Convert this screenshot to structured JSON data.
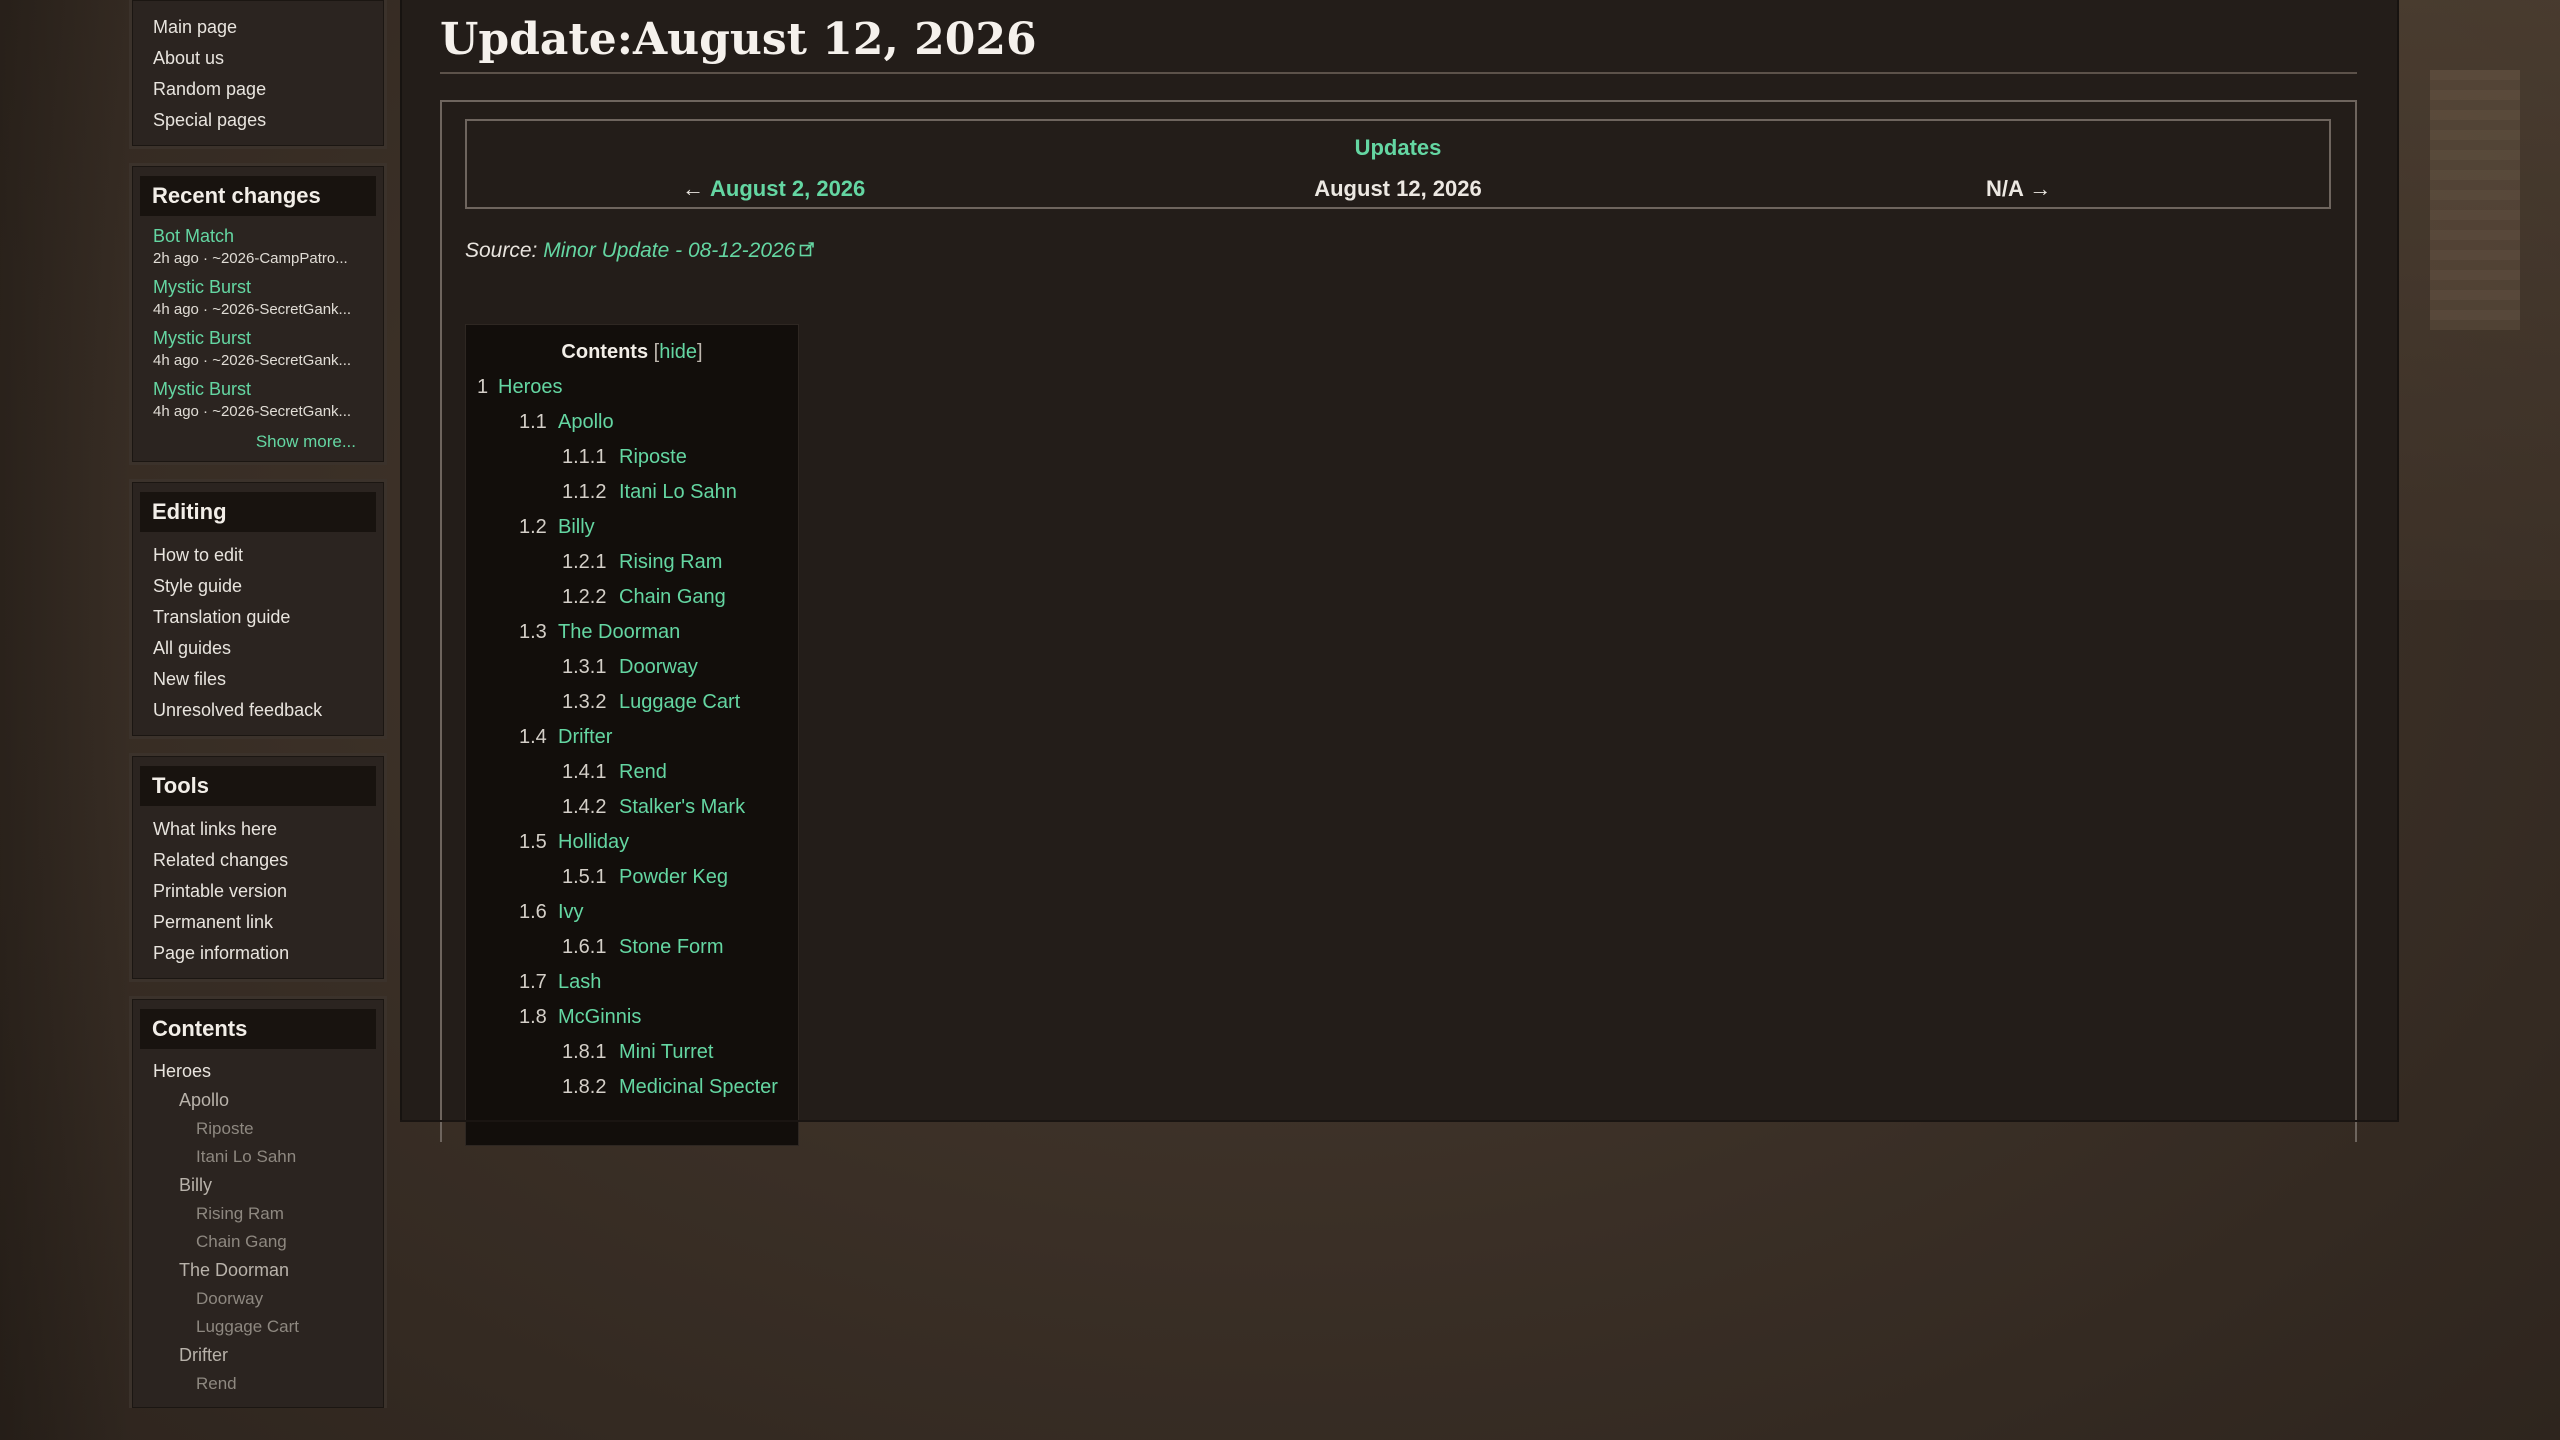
{
  "page": {
    "title": "Update:August 12, 2026"
  },
  "sidebar": {
    "navigation": [
      "Main page",
      "About us",
      "Random page",
      "Special pages"
    ],
    "recent_changes": {
      "heading": "Recent changes",
      "items": [
        {
          "title": "Bot Match",
          "meta": "2h ago · ~2026-CampPatro..."
        },
        {
          "title": "Mystic Burst",
          "meta": "4h ago · ~2026-SecretGank..."
        },
        {
          "title": "Mystic Burst",
          "meta": "4h ago · ~2026-SecretGank..."
        },
        {
          "title": "Mystic Burst",
          "meta": "4h ago · ~2026-SecretGank..."
        }
      ],
      "show_more": "Show more..."
    },
    "editing": {
      "heading": "Editing",
      "items": [
        "How to edit",
        "Style guide",
        "Translation guide",
        "All guides",
        "New files",
        "Unresolved feedback"
      ]
    },
    "tools": {
      "heading": "Tools",
      "items": [
        "What links here",
        "Related changes",
        "Printable version",
        "Permanent link",
        "Page information"
      ]
    },
    "contents": {
      "heading": "Contents",
      "items": [
        {
          "level": 1,
          "label": "Heroes"
        },
        {
          "level": 2,
          "label": "Apollo"
        },
        {
          "level": 3,
          "label": "Riposte"
        },
        {
          "level": 3,
          "label": "Itani Lo Sahn"
        },
        {
          "level": 2,
          "label": "Billy"
        },
        {
          "level": 3,
          "label": "Rising Ram"
        },
        {
          "level": 3,
          "label": "Chain Gang"
        },
        {
          "level": 2,
          "label": "The Doorman"
        },
        {
          "level": 3,
          "label": "Doorway"
        },
        {
          "level": 3,
          "label": "Luggage Cart"
        },
        {
          "level": 2,
          "label": "Drifter"
        },
        {
          "level": 3,
          "label": "Rend"
        }
      ]
    }
  },
  "updates_nav": {
    "title": "Updates",
    "prev_label": "August 2, 2026",
    "prev_arrow": "←",
    "current": "August 12, 2026",
    "next_label": "N/A",
    "next_arrow": "→"
  },
  "source": {
    "prefix": "Source:",
    "link_text": "Minor Update - 08-12-2026"
  },
  "toc": {
    "heading": "Contents",
    "hide_bracket_open": "[",
    "hide_label": "hide",
    "hide_bracket_close": "]",
    "items": [
      {
        "num": "1",
        "label": "Heroes",
        "level": 1
      },
      {
        "num": "1.1",
        "label": "Apollo",
        "level": 2
      },
      {
        "num": "1.1.1",
        "label": "Riposte",
        "level": 3
      },
      {
        "num": "1.1.2",
        "label": "Itani Lo Sahn",
        "level": 3
      },
      {
        "num": "1.2",
        "label": "Billy",
        "level": 2
      },
      {
        "num": "1.2.1",
        "label": "Rising Ram",
        "level": 3
      },
      {
        "num": "1.2.2",
        "label": "Chain Gang",
        "level": 3
      },
      {
        "num": "1.3",
        "label": "The Doorman",
        "level": 2
      },
      {
        "num": "1.3.1",
        "label": "Doorway",
        "level": 3
      },
      {
        "num": "1.3.2",
        "label": "Luggage Cart",
        "level": 3
      },
      {
        "num": "1.4",
        "label": "Drifter",
        "level": 2
      },
      {
        "num": "1.4.1",
        "label": "Rend",
        "level": 3
      },
      {
        "num": "1.4.2",
        "label": "Stalker's Mark",
        "level": 3
      },
      {
        "num": "1.5",
        "label": "Holliday",
        "level": 2
      },
      {
        "num": "1.5.1",
        "label": "Powder Keg",
        "level": 3
      },
      {
        "num": "1.6",
        "label": "Ivy",
        "level": 2
      },
      {
        "num": "1.6.1",
        "label": "Stone Form",
        "level": 3
      },
      {
        "num": "1.7",
        "label": "Lash",
        "level": 2
      },
      {
        "num": "1.8",
        "label": "McGinnis",
        "level": 2
      },
      {
        "num": "1.8.1",
        "label": "Mini Turret",
        "level": 3
      },
      {
        "num": "1.8.2",
        "label": "Medicinal Specter",
        "level": 3
      }
    ]
  },
  "colors": {
    "link": "#64d6a2",
    "background": "#3a2f26",
    "content_bg": "#231d19"
  }
}
